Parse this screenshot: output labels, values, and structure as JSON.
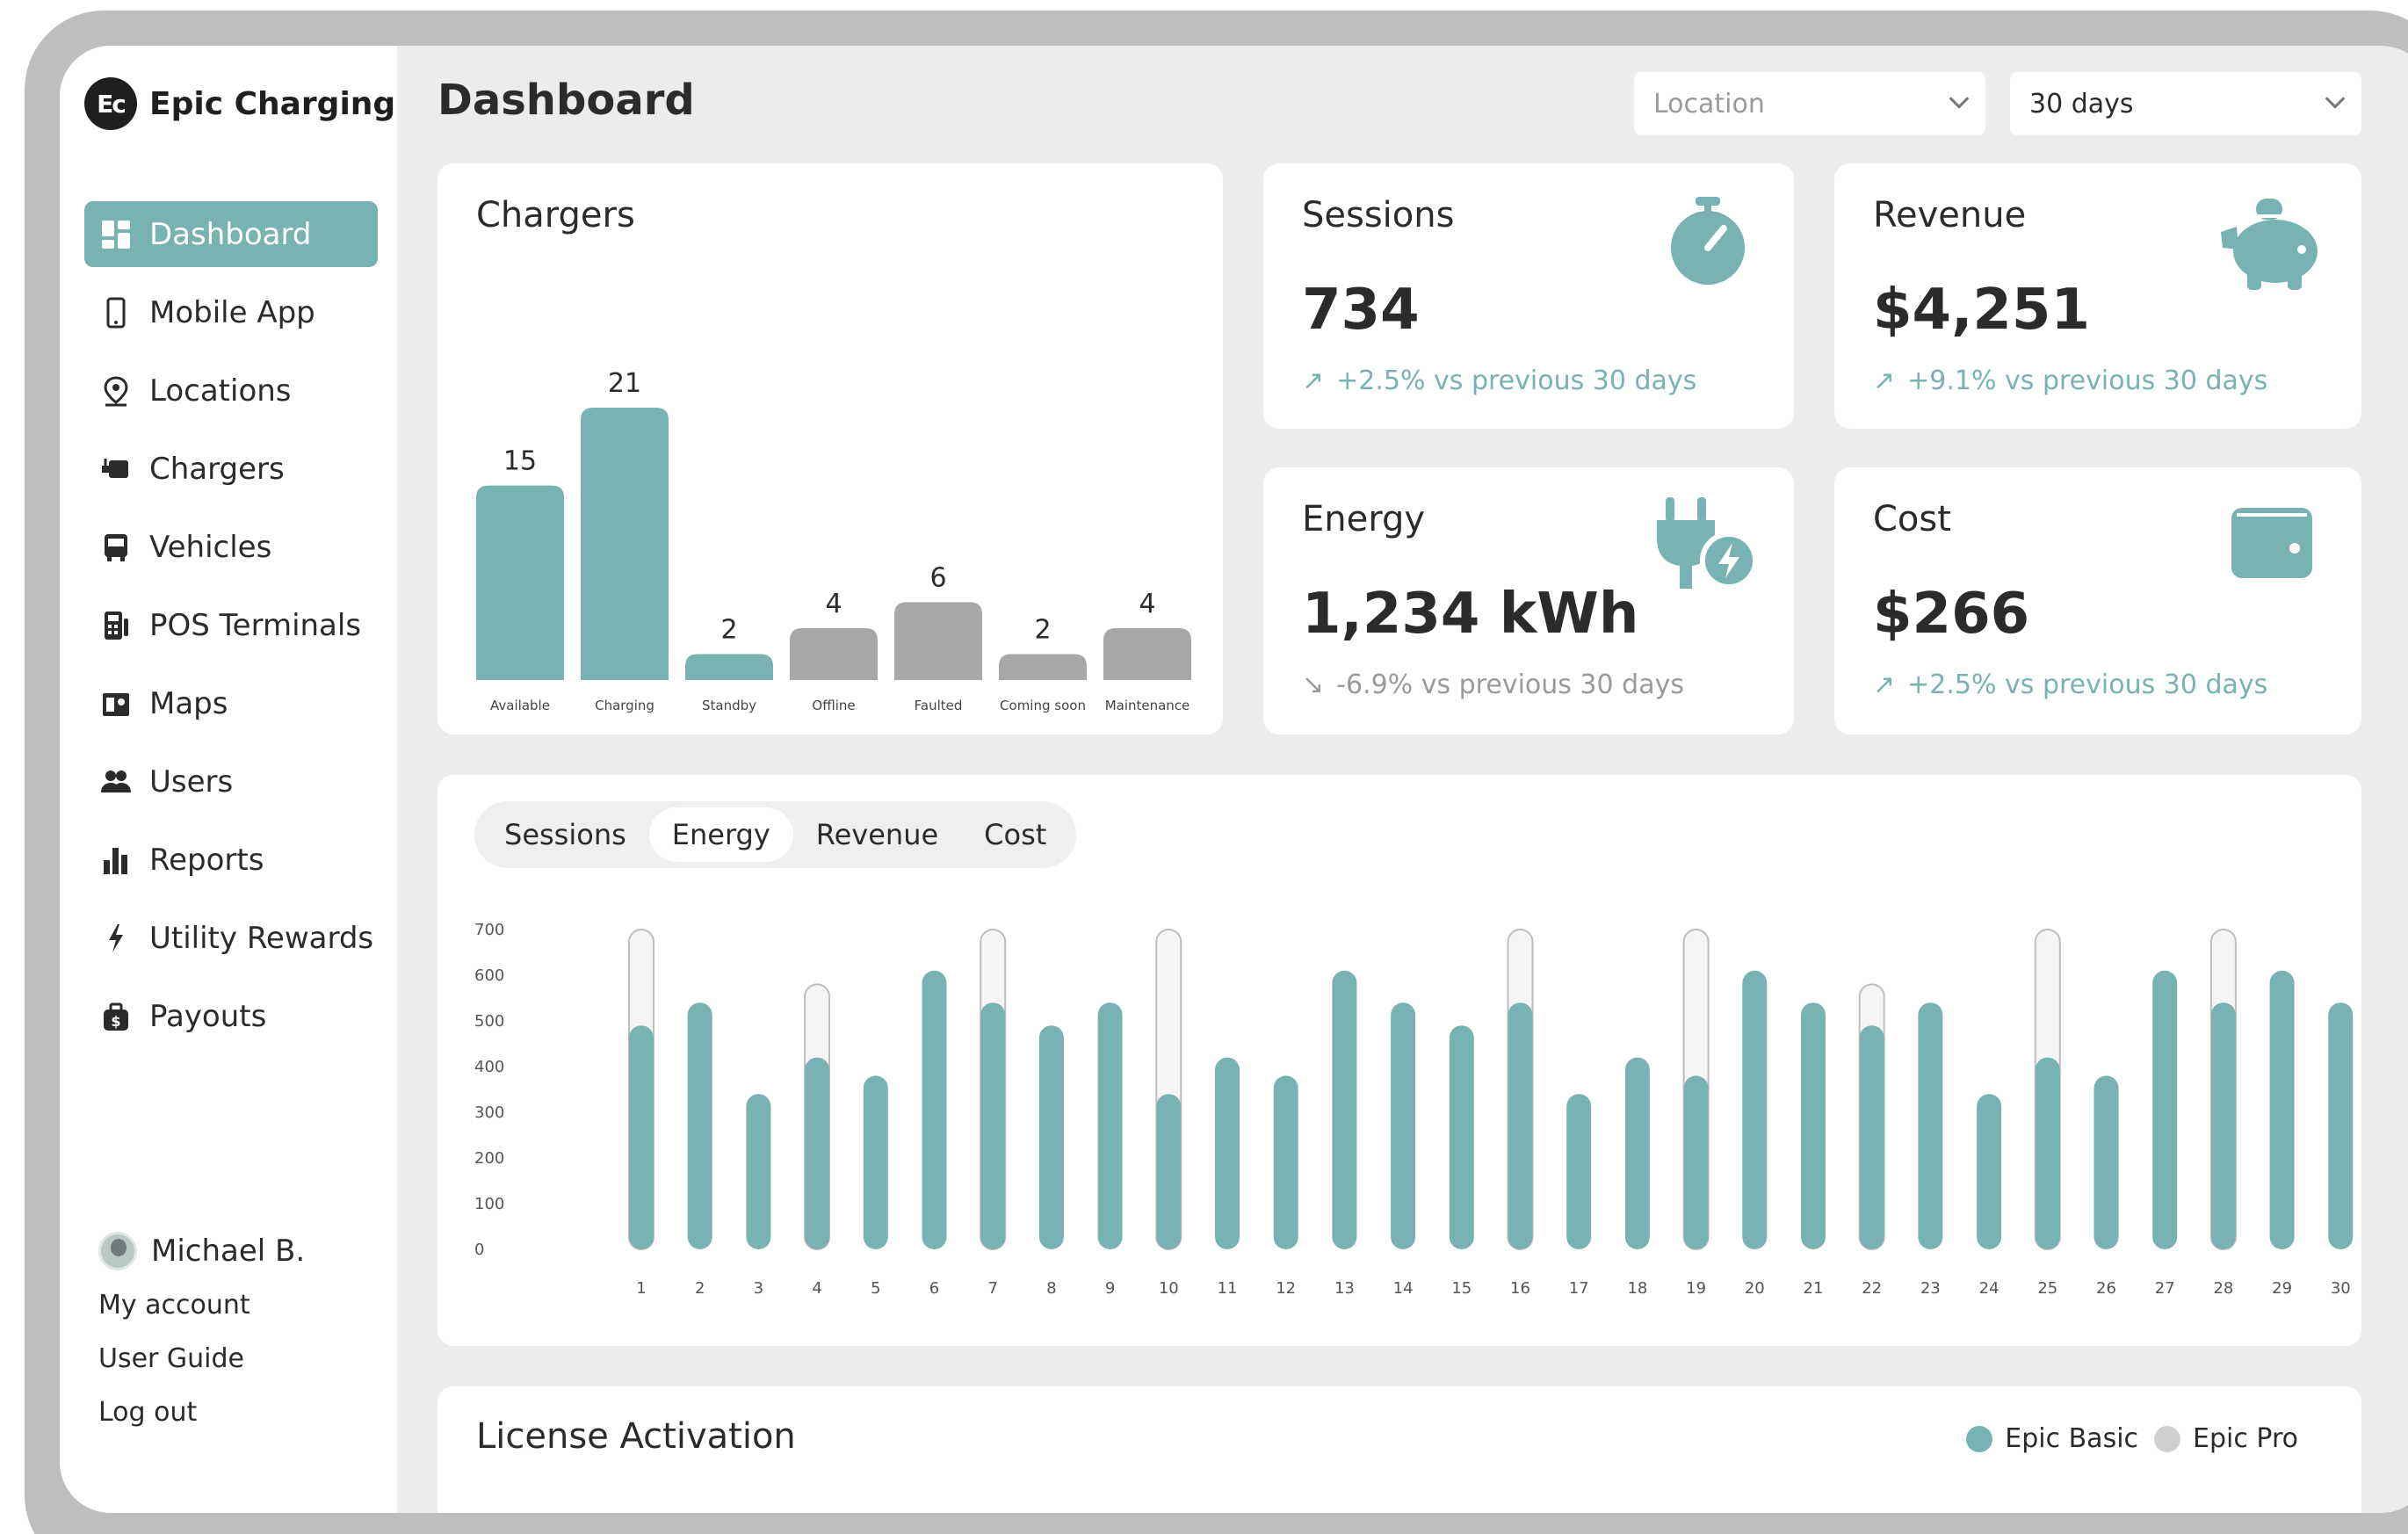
{
  "brand": {
    "logo_text": "Ec",
    "name": "Epic Charging"
  },
  "nav": [
    {
      "label": "Dashboard",
      "icon": "dashboard-icon",
      "active": true
    },
    {
      "label": "Mobile App",
      "icon": "phone-icon"
    },
    {
      "label": "Locations",
      "icon": "location-pin-icon"
    },
    {
      "label": "Chargers",
      "icon": "charger-icon"
    },
    {
      "label": "Vehicles",
      "icon": "bus-icon"
    },
    {
      "label": "POS Terminals",
      "icon": "pos-terminal-icon"
    },
    {
      "label": "Maps",
      "icon": "map-icon"
    },
    {
      "label": "Users",
      "icon": "users-icon"
    },
    {
      "label": "Reports",
      "icon": "bar-chart-icon"
    },
    {
      "label": "Utility Rewards",
      "icon": "lightning-icon"
    },
    {
      "label": "Payouts",
      "icon": "money-bag-icon"
    }
  ],
  "user": {
    "name": "Michael B.",
    "links": [
      "My account",
      "User Guide",
      "Log out"
    ]
  },
  "header": {
    "title": "Dashboard",
    "location_placeholder": "Location",
    "period_value": "30 days"
  },
  "chargers": {
    "title": "Chargers",
    "colors": {
      "teal": "#78b2b3",
      "gray": "#a7a7a7"
    }
  },
  "kpis": {
    "sessions": {
      "title": "Sessions",
      "value": "734",
      "trend": "+2.5% vs previous 30 days",
      "direction": "up",
      "icon": "stopwatch-icon"
    },
    "revenue": {
      "title": "Revenue",
      "value": "$4,251",
      "trend": "+9.1% vs previous 30 days",
      "direction": "up",
      "icon": "piggy-bank-icon"
    },
    "energy": {
      "title": "Energy",
      "value": "1,234 kWh",
      "trend": "-6.9% vs previous 30 days",
      "direction": "down",
      "icon": "plug-icon"
    },
    "cost": {
      "title": "Cost",
      "value": "$266",
      "trend": "+2.5% vs previous 30 days",
      "direction": "up",
      "icon": "wallet-icon"
    }
  },
  "usage": {
    "tabs": [
      "Sessions",
      "Energy",
      "Revenue",
      "Cost"
    ],
    "active_tab": "Energy"
  },
  "license": {
    "title": "License Activation",
    "legend": [
      {
        "name": "Epic Basic",
        "color": "#78b2b3"
      },
      {
        "name": "Epic Pro",
        "color": "#cfcfcf"
      }
    ]
  },
  "chart_data": [
    {
      "type": "bar",
      "title": "Chargers",
      "categories": [
        "Available",
        "Charging",
        "Standby",
        "Offline",
        "Faulted",
        "Coming soon",
        "Maintenance"
      ],
      "values": [
        15,
        21,
        2,
        4,
        6,
        2,
        4
      ],
      "bar_colors": [
        "#78b2b3",
        "#78b2b3",
        "#78b2b3",
        "#a7a7a7",
        "#a7a7a7",
        "#a7a7a7",
        "#a7a7a7"
      ],
      "data_labels": true
    },
    {
      "type": "bar",
      "title": "",
      "categories": [
        "1",
        "2",
        "3",
        "4",
        "5",
        "6",
        "7",
        "8",
        "9",
        "10",
        "11",
        "12",
        "13",
        "14",
        "15",
        "16",
        "17",
        "18",
        "19",
        "20",
        "21",
        "22",
        "23",
        "24",
        "25",
        "26",
        "27",
        "28",
        "29",
        "30"
      ],
      "ylim": [
        0,
        700
      ],
      "yticks": [
        "700",
        "600",
        "500",
        "400",
        "300",
        "200",
        "100",
        "0"
      ],
      "series": [
        {
          "values": [
            490,
            540,
            340,
            420,
            380,
            610,
            540,
            490,
            540,
            340,
            420,
            380,
            610,
            540,
            490,
            540,
            340,
            420,
            380,
            610,
            540,
            490,
            540,
            340,
            420,
            380,
            610,
            540,
            610,
            540
          ],
          "color": "#78b2b3"
        },
        {
          "values": [
            700,
            540,
            340,
            580,
            380,
            610,
            700,
            490,
            540,
            700,
            420,
            380,
            610,
            540,
            490,
            700,
            340,
            420,
            700,
            610,
            540,
            580,
            540,
            340,
            700,
            380,
            610,
            700,
            610,
            540
          ],
          "color": "#f5f5f5"
        }
      ]
    }
  ]
}
